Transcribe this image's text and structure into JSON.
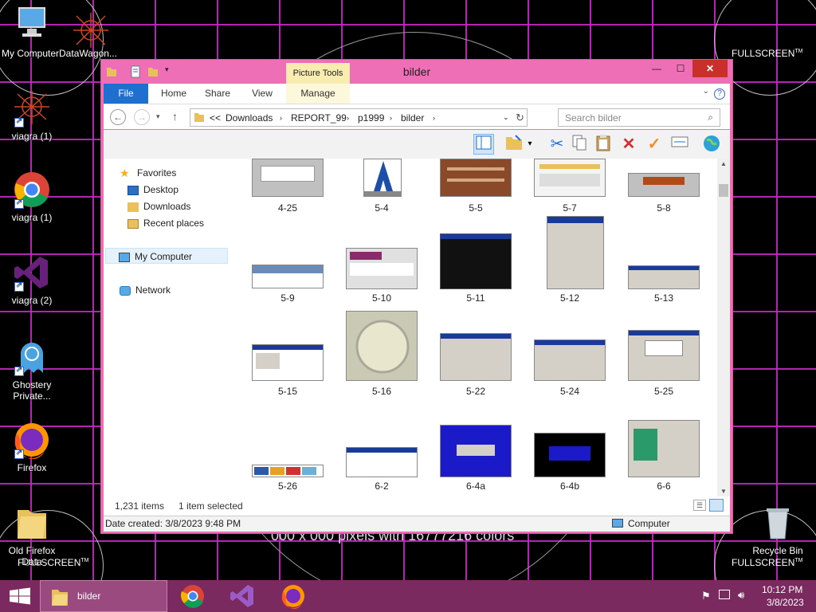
{
  "desktop": {
    "wall_left": "FULLSCREEN",
    "wall_right_top": "FULLSCREEN",
    "wall_right_bottom": "FULLSCREEN",
    "wall_left_bottom": "FULLSCREEN",
    "tm": "TM",
    "big_text": "000 x 000 pixels with 16777216 colors",
    "icons": [
      {
        "label": "My ComputerDataWagon..."
      },
      {
        "label": "viagra (1)"
      },
      {
        "label": "viagra (1)"
      },
      {
        "label": "viagra (2)"
      },
      {
        "label": "Ghostery Private..."
      },
      {
        "label": "Firefox"
      },
      {
        "label": "Old Firefox Data"
      },
      {
        "label": "Recycle Bin"
      }
    ]
  },
  "window": {
    "title": "bilder",
    "context_group": "Picture Tools",
    "tabs": [
      "File",
      "Home",
      "Share",
      "View",
      "Manage"
    ],
    "minimize": "—",
    "maximize": "☐",
    "close": "✕",
    "address": {
      "overflow": "<<",
      "crumbs": [
        "Downloads",
        "REPORT_99",
        "p1999",
        "bilder"
      ]
    },
    "search_placeholder": "Search bilder",
    "nav": {
      "favorites": "Favorites",
      "desktop": "Desktop",
      "downloads": "Downloads",
      "recent": "Recent places",
      "computer": "My Computer",
      "network": "Network"
    },
    "files": [
      "4-25",
      "5-4",
      "5-5",
      "5-7",
      "5-8",
      "5-9",
      "5-10",
      "5-11",
      "5-12",
      "5-13",
      "5-15",
      "5-16",
      "5-22",
      "5-24",
      "5-25",
      "5-26",
      "6-2",
      "6-4a",
      "6-4b",
      "6-6"
    ],
    "status": {
      "items": "1,231 items",
      "selected": "1 item selected"
    },
    "details": {
      "date": "Date created: 3/8/2023 9:48 PM",
      "location": "Computer"
    }
  },
  "taskbar": {
    "task_label": "bilder",
    "time": "10:12 PM",
    "date": "3/8/2023"
  },
  "colors": {
    "window_frame": "#ee6fb6",
    "file_tab": "#1e6fcf",
    "taskbar": "#7a2a5e",
    "grid": "#c828c8"
  }
}
